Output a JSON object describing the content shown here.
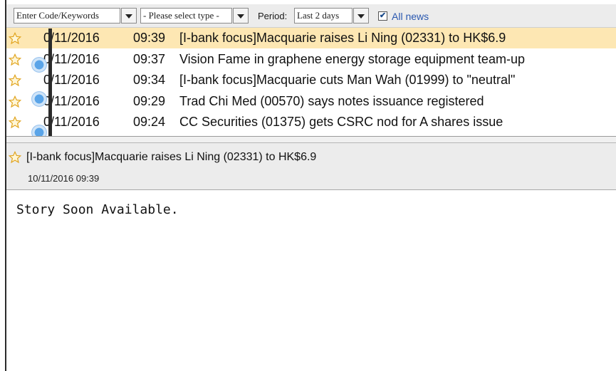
{
  "toolbar": {
    "keyword_placeholder": "Enter Code/Keywords",
    "type_select": "- Please select type -",
    "period_label": "Period:",
    "period_value": "Last 2 days",
    "all_news_label": "All news",
    "all_news_checked": true
  },
  "news": [
    {
      "date": "0/11/2016",
      "time": "09:39",
      "headline": "[I-bank focus]Macquarie raises Li Ning (02331) to HK$6.9",
      "selected": true
    },
    {
      "date": "0/11/2016",
      "time": "09:37",
      "headline": "Vision Fame in graphene energy storage equipment team-up",
      "selected": false
    },
    {
      "date": "0/11/2016",
      "time": "09:34",
      "headline": "[I-bank focus]Macquarie cuts Man Wah (01999) to \"neutral\"",
      "selected": false
    },
    {
      "date": "0/11/2016",
      "time": "09:29",
      "headline": "Trad Chi Med (00570) says notes issuance registered",
      "selected": false
    },
    {
      "date": "0/11/2016",
      "time": "09:24",
      "headline": "CC Securities (01375) gets CSRC nod for A shares issue",
      "selected": false
    }
  ],
  "detail": {
    "title": "[I-bank focus]Macquarie raises Li Ning (02331) to HK$6.9",
    "timestamp": "10/11/2016 09:39",
    "body": "Story Soon Available."
  },
  "colors": {
    "selected_row": "#fde7b3",
    "star_outline": "#e0a21a",
    "dot_blue": "#5aa4e8",
    "link_blue": "#2a58b0"
  }
}
